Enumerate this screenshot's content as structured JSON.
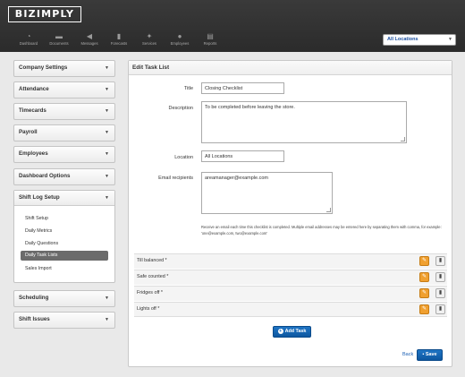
{
  "brand": "BIZIMPLY",
  "nav": [
    {
      "label": "Dashboard",
      "icon": "dashboard-icon",
      "glyph": "◔"
    },
    {
      "label": "Documents",
      "icon": "folder-icon",
      "glyph": "▬"
    },
    {
      "label": "Messages",
      "icon": "megaphone-icon",
      "glyph": "◀"
    },
    {
      "label": "Forecasts",
      "icon": "bar-chart-icon",
      "glyph": "▮"
    },
    {
      "label": "Services",
      "icon": "services-icon",
      "glyph": "✦"
    },
    {
      "label": "Employees",
      "icon": "employees-icon",
      "glyph": "●"
    },
    {
      "label": "Reports",
      "icon": "reports-icon",
      "glyph": "▤"
    }
  ],
  "location_select": {
    "value": "All Locations"
  },
  "sidebar": {
    "company_settings": "Company Settings",
    "attendance": "Attendance",
    "timecards": "Timecards",
    "payroll": "Payroll",
    "employees": "Employees",
    "dashboard_options": "Dashboard Options",
    "shift_log_setup": "Shift Log Setup",
    "shift_log_items": [
      "Shift Setup",
      "Daily Metrics",
      "Daily Questions",
      "Daily Task Lists",
      "Sales Import"
    ],
    "scheduling": "Scheduling",
    "shift_issues": "Shift Issues"
  },
  "form": {
    "header": "Edit Task List",
    "title_label": "Title",
    "title_value": "Closing Checklist",
    "description_label": "Description",
    "description_value": "To be completed before leaving the store.",
    "location_label": "Location",
    "location_value": "All Locations",
    "email_label": "Email recipients",
    "email_value": "areamanager@example.com",
    "help_text": "Receive an email each time this checklist is completed. Multiple email addresses may be entered here by separating them with comma, for example: 'one@example.com, two@example.com'"
  },
  "tasks": [
    "Till balanced *",
    "Safe counted *",
    "Fridges off *",
    "Lights off *"
  ],
  "buttons": {
    "add_task": "Add Task",
    "back": "Back",
    "save": "Save"
  },
  "colors": {
    "primary_blue": "#1565b8",
    "edit_orange": "#f0a030",
    "topbar": "#2f2f2f"
  }
}
